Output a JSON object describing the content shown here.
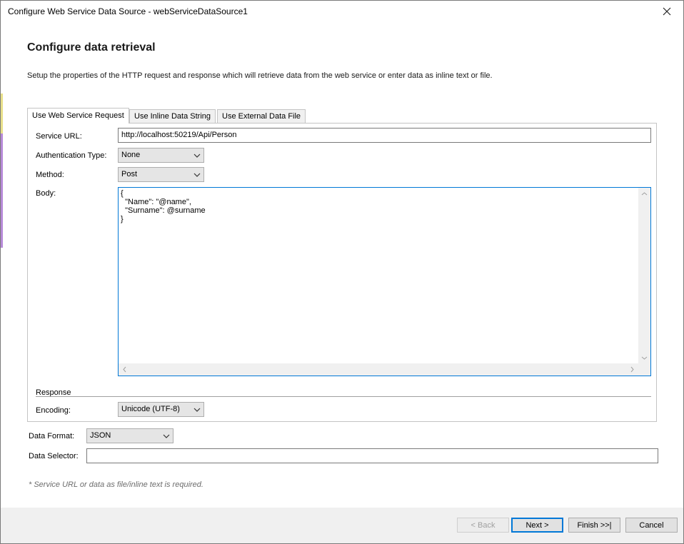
{
  "window": {
    "title": "Configure Web Service Data Source - webServiceDataSource1"
  },
  "header": {
    "heading": "Configure data retrieval",
    "description": "Setup the properties of the HTTP request and response which will retrieve data from the web service or enter data as inline text or file."
  },
  "tabs": [
    {
      "label": "Use Web Service Request",
      "active": true
    },
    {
      "label": "Use Inline Data String",
      "active": false
    },
    {
      "label": "Use External Data File",
      "active": false
    }
  ],
  "request": {
    "service_url_label": "Service URL:",
    "service_url_value": "http://localhost:50219/Api/Person",
    "auth_type_label": "Authentication Type:",
    "auth_type_value": "None",
    "method_label": "Method:",
    "method_value": "Post",
    "body_label": "Body:",
    "body_value": "{\n  \"Name\": \"@name\",\n  \"Surname\": @surname\n}"
  },
  "response": {
    "section_label": "Response",
    "encoding_label": "Encoding:",
    "encoding_value": "Unicode (UTF-8)"
  },
  "data": {
    "format_label": "Data Format:",
    "format_value": "JSON",
    "selector_label": "Data Selector:",
    "selector_value": ""
  },
  "footnote": "* Service URL or data as file/inline text is required.",
  "buttons": {
    "back": "< Back",
    "next": "Next >",
    "finish": "Finish >>|",
    "cancel": "Cancel"
  },
  "icons": {
    "close": "close-icon",
    "dropdown": "chevron-down-icon",
    "scroll_up": "chevron-up-icon",
    "scroll_down": "chevron-down-icon",
    "scroll_left": "chevron-left-icon",
    "scroll_right": "chevron-right-icon"
  },
  "colors": {
    "focus_border": "#0078d7",
    "footer_bg": "#f0f0f0"
  }
}
